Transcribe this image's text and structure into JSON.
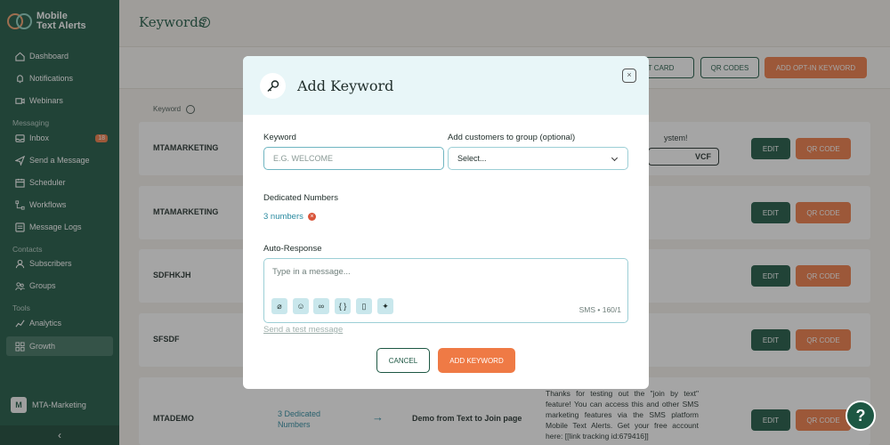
{
  "app": {
    "logo_line1": "Mobile",
    "logo_line2": "Text Alerts"
  },
  "sidebar": {
    "items": [
      {
        "label": "Dashboard"
      },
      {
        "label": "Notifications"
      },
      {
        "label": "Webinars"
      }
    ],
    "messaging_heading": "Messaging",
    "messaging_items": [
      {
        "label": "Inbox",
        "badge": "18"
      },
      {
        "label": "Send a Message"
      },
      {
        "label": "Scheduler"
      },
      {
        "label": "Workflows"
      },
      {
        "label": "Message Logs"
      }
    ],
    "contacts_heading": "Contacts",
    "contacts_items": [
      {
        "label": "Subscribers"
      },
      {
        "label": "Groups"
      }
    ],
    "tools_heading": "Tools",
    "tools_items": [
      {
        "label": "Analytics"
      },
      {
        "label": "Growth"
      }
    ],
    "user_initial": "M",
    "user_name": "MTA-Marketing",
    "collapse_glyph": "‹"
  },
  "page": {
    "title": "Keywords",
    "help_glyph": "?",
    "buttons": {
      "contact_card": "ACT CARD",
      "qr_codes": "QR CODES",
      "add_opt_in": "ADD OPT-IN KEYWORD"
    },
    "column_keyword": "Keyword",
    "rows": [
      {
        "keyword": "MTAMARKETING",
        "edit": "EDIT",
        "qr": "QR CODE"
      },
      {
        "keyword": "MTAMARKETING",
        "edit": "EDIT",
        "qr": "QR CODE"
      },
      {
        "keyword": "SDFHKJH",
        "edit": "EDIT",
        "qr": "QR CODE"
      },
      {
        "keyword": "SFSDF",
        "edit": "EDIT",
        "qr": "QR CODE"
      },
      {
        "keyword": "MTADEMO",
        "edit": "EDIT",
        "qr": "QR CODE"
      }
    ],
    "row1_snippet": "ystem!",
    "row1_vcf": "VCF",
    "row5_numbers": "3 Dedicated Numbers",
    "row5_arrow": "→",
    "row5_name": "Demo from Text to Join page",
    "row5_message": "Thanks for testing out the \"join by text\" feature! You can access this and other SMS marketing features via the SMS platform Mobile Text Alerts. Get your free account here: [[link tracking id:679416]]"
  },
  "modal": {
    "title": "Add Keyword",
    "close_glyph": "×",
    "keyword_label": "Keyword",
    "keyword_placeholder": "E.G. WELCOME",
    "group_label": "Add customers to group (optional)",
    "group_value": "Select...",
    "dedicated_label": "Dedicated Numbers",
    "dedicated_value": "3 numbers",
    "remove_glyph": "×",
    "auto_response_label": "Auto-Response",
    "message_placeholder": "Type in a message...",
    "counter": "SMS • 160/1",
    "tools": [
      {
        "glyph": "⌀"
      },
      {
        "glyph": "☺"
      },
      {
        "glyph": "∞"
      },
      {
        "glyph": "{ }"
      },
      {
        "glyph": "▯"
      },
      {
        "glyph": "✦"
      }
    ],
    "test_link": "Send a test message",
    "cancel": "CANCEL",
    "add": "ADD KEYWORD"
  },
  "help_fab_glyph": "?",
  "colors": {
    "brand_green": "#1d5743",
    "accent_orange": "#ef7a45",
    "modal_header": "#e8f6f8"
  }
}
